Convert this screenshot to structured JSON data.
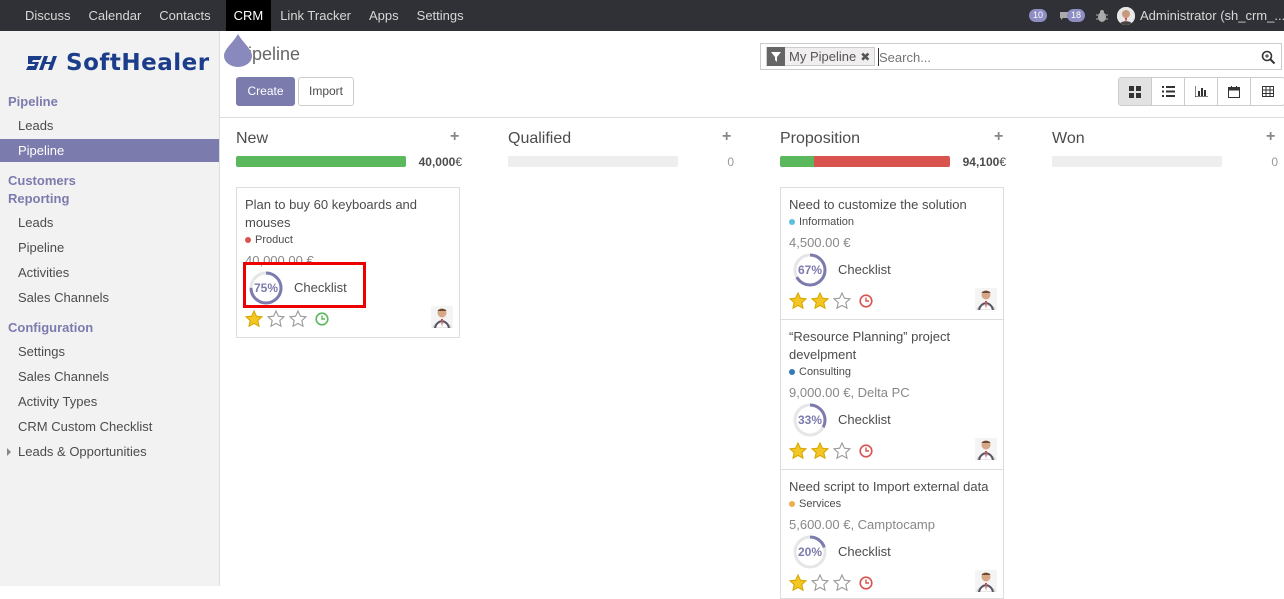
{
  "topbar": {
    "menu": [
      "Discuss",
      "Calendar",
      "Contacts",
      "CRM",
      "Link Tracker",
      "Apps",
      "Settings"
    ],
    "active": "CRM",
    "badges": {
      "messages": "10",
      "chat": "18"
    },
    "user": "Administrator (sh_crm_..."
  },
  "sidebar": {
    "logo_text": "SoftHealer",
    "sections": {
      "pipeline": "Pipeline",
      "customers": "Customers",
      "reporting": "Reporting",
      "configuration": "Configuration"
    },
    "items": {
      "leads": "Leads",
      "pipeline": "Pipeline",
      "r_leads": "Leads",
      "r_pipeline": "Pipeline",
      "activities": "Activities",
      "sales_channels": "Sales Channels",
      "settings": "Settings",
      "c_sales_channels": "Sales Channels",
      "activity_types": "Activity Types",
      "custom_checklist": "CRM Custom Checklist",
      "leads_opps": "Leads & Opportunities"
    }
  },
  "control": {
    "breadcrumb": "Pipeline",
    "create": "Create",
    "import": "Import",
    "facet": "My Pipeline",
    "search_placeholder": "Search..."
  },
  "colors": {
    "accent": "#7c7bad",
    "green": "#5cb85c",
    "red": "#d9534f",
    "star": "#f3c623"
  },
  "columns": [
    {
      "title": "New",
      "sum": "40,000",
      "currency": "€",
      "green": 1.0,
      "red": 0.0
    },
    {
      "title": "Qualified",
      "sum": "0",
      "currency": "",
      "green": 0.0,
      "red": 0.0
    },
    {
      "title": "Proposition",
      "sum": "94,100",
      "currency": "€",
      "green": 0.2,
      "red": 0.8
    },
    {
      "title": "Won",
      "sum": "0",
      "currency": "",
      "green": 0.0,
      "red": 0.0
    }
  ],
  "cards": [
    {
      "title": "Plan to buy 60 keyboards and mouses",
      "tag": "Product",
      "tag_color": "#d9534f",
      "amount": "40,000.00 €",
      "progress": "75%",
      "progress_value": 0.75,
      "checklist": "Checklist",
      "stars": 1,
      "clock_color": "#5cb85c"
    },
    {
      "title": "Need to customize the solution",
      "tag": "Information",
      "tag_color": "#5bc0de",
      "amount": "4,500.00 €",
      "progress": "67%",
      "progress_value": 0.67,
      "checklist": "Checklist",
      "stars": 2,
      "clock_color": "#d9534f"
    },
    {
      "title": "“Resource Planning” project develpment",
      "tag": "Consulting",
      "tag_color": "#337ab7",
      "amount": "9,000.00 €, Delta PC",
      "progress": "33%",
      "progress_value": 0.33,
      "checklist": "Checklist",
      "stars": 2,
      "clock_color": "#d9534f"
    },
    {
      "title": "Need script to Import external data",
      "tag": "Services",
      "tag_color": "#f0ad4e",
      "amount": "5,600.00 €, Camptocamp",
      "progress": "20%",
      "progress_value": 0.2,
      "checklist": "Checklist",
      "stars": 1,
      "clock_color": "#d9534f"
    }
  ]
}
